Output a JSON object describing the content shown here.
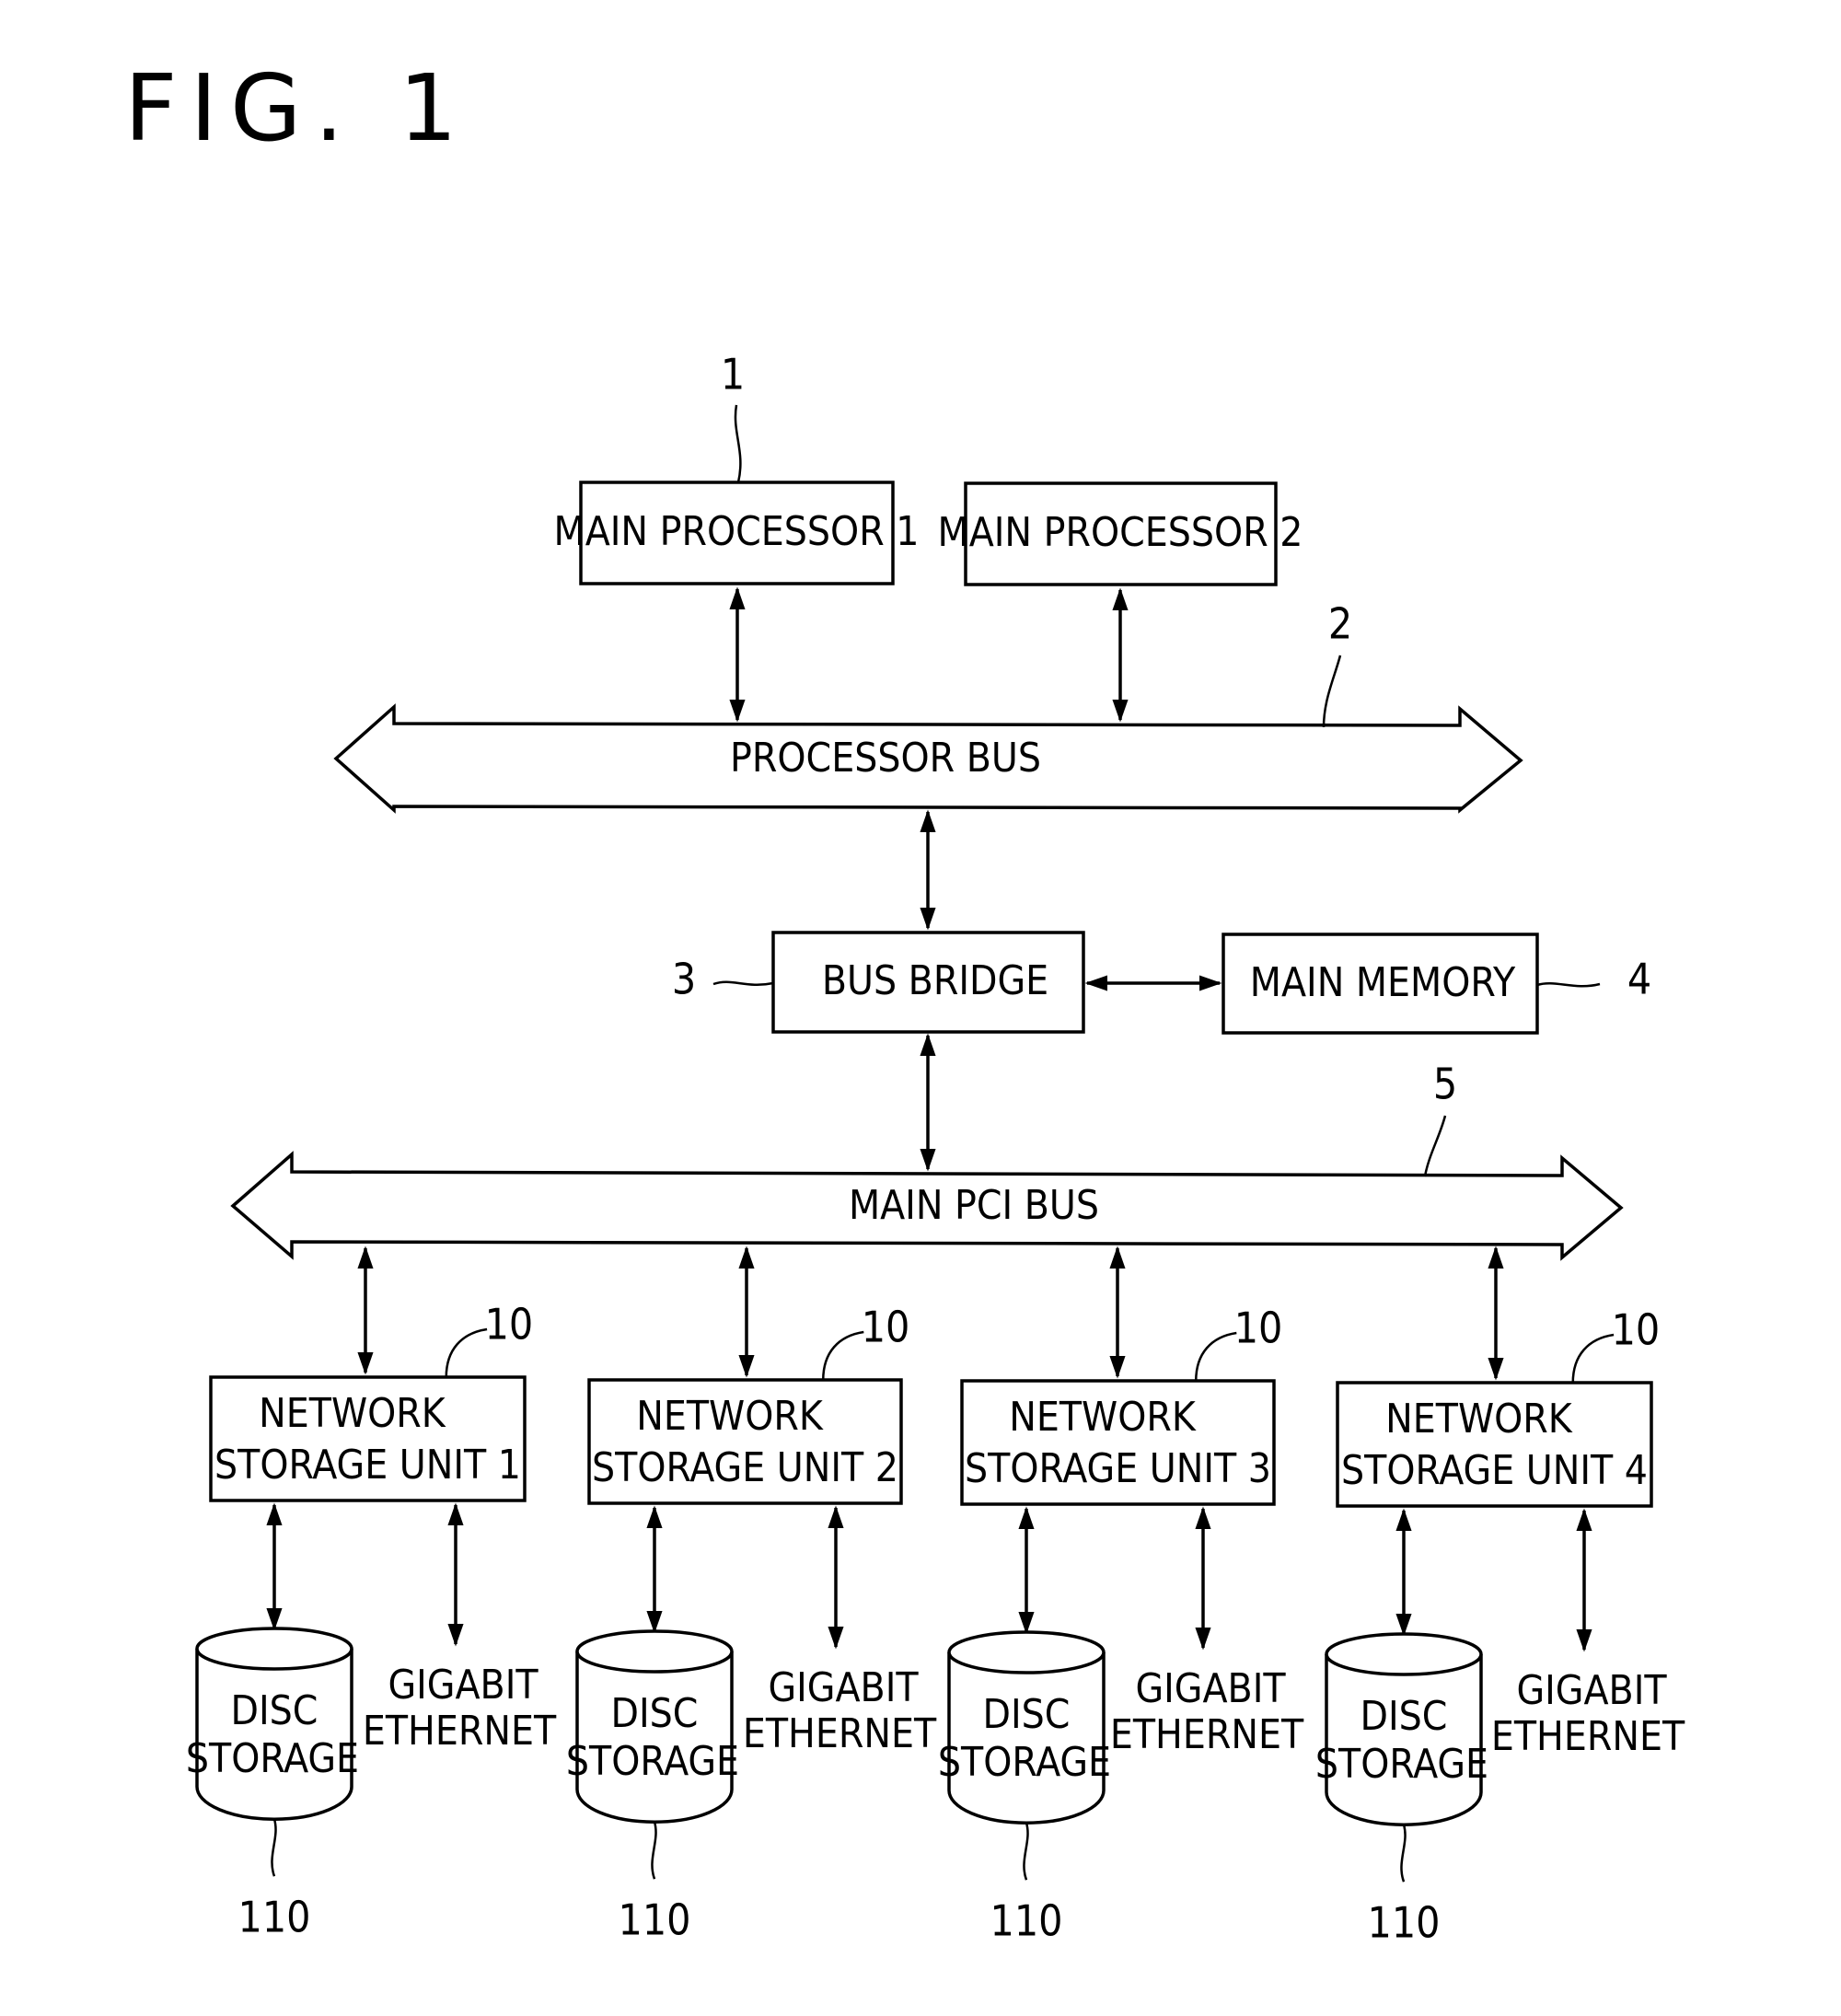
{
  "figure": {
    "title": "FIG. 1"
  },
  "processors": [
    {
      "label": "MAIN PROCESSOR 1",
      "ref": "1"
    },
    {
      "label": "MAIN PROCESSOR 2"
    }
  ],
  "processor_bus": {
    "label": "PROCESSOR BUS",
    "ref": "2"
  },
  "bus_bridge": {
    "label": "BUS BRIDGE",
    "ref": "3"
  },
  "main_memory": {
    "label": "MAIN MEMORY",
    "ref": "4"
  },
  "pci_bus": {
    "label": "MAIN PCI BUS",
    "ref": "5"
  },
  "storage_units": [
    {
      "line1": "NETWORK",
      "line2": "STORAGE UNIT 1",
      "ref": "10",
      "disc": {
        "line1": "DISC",
        "line2": "STORAGE",
        "ref": "110"
      },
      "ethernet": {
        "line1": "GIGABIT",
        "line2": "ETHERNET"
      }
    },
    {
      "line1": "NETWORK",
      "line2": "STORAGE UNIT 2",
      "ref": "10",
      "disc": {
        "line1": "DISC",
        "line2": "STORAGE",
        "ref": "110"
      },
      "ethernet": {
        "line1": "GIGABIT",
        "line2": "ETHERNET"
      }
    },
    {
      "line1": "NETWORK",
      "line2": "STORAGE UNIT 3",
      "ref": "10",
      "disc": {
        "line1": "DISC",
        "line2": "STORAGE",
        "ref": "110"
      },
      "ethernet": {
        "line1": "GIGABIT",
        "line2": "ETHERNET"
      }
    },
    {
      "line1": "NETWORK",
      "line2": "STORAGE UNIT 4",
      "ref": "10",
      "disc": {
        "line1": "DISC",
        "line2": "STORAGE",
        "ref": "110"
      },
      "ethernet": {
        "line1": "GIGABIT",
        "line2": "ETHERNET"
      }
    }
  ]
}
